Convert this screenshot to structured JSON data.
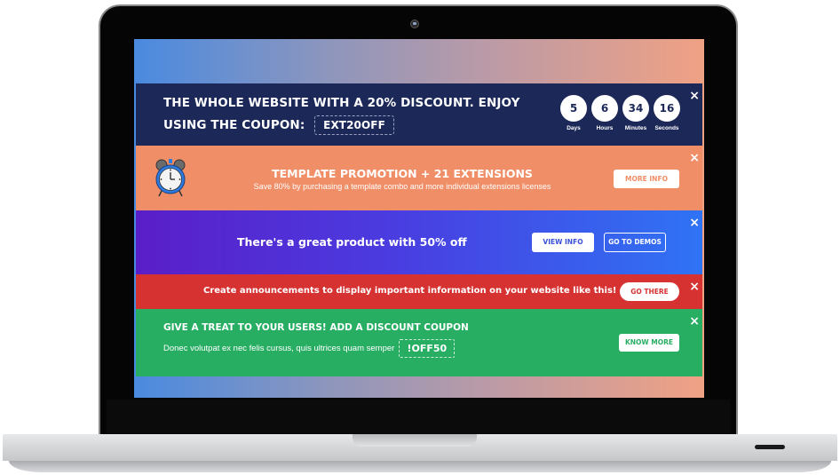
{
  "banners": {
    "countdown": {
      "headline": "THE WHOLE WEBSITE WITH A 20% DISCOUNT. ENJOY USING THE COUPON:",
      "coupon_code": "EXT20OFF",
      "timer": [
        {
          "value": "5",
          "label": "Days"
        },
        {
          "value": "6",
          "label": "Hours"
        },
        {
          "value": "34",
          "label": "Minutes"
        },
        {
          "value": "16",
          "label": "Seconds"
        }
      ],
      "close_icon": "×",
      "color": "#1c2858"
    },
    "promotion": {
      "icon": "alarm-clock-icon",
      "title": "TEMPLATE PROMOTION + 21 EXTENSIONS",
      "subtitle": "Save 80% by purchasing a template combo and more individual extensions licenses",
      "button_label": "MORE INFO",
      "close_icon": "×",
      "color": "#f08e67"
    },
    "product": {
      "title": "There's a great product with 50% off",
      "button1_label": "VIEW INFO",
      "button2_label": "GO TO DEMOS",
      "close_icon": "×",
      "gradient": [
        "#5a1ec8",
        "#2f73f5"
      ]
    },
    "announcement": {
      "title": "Create announcements to display important information on your website like this!",
      "button_label": "GO THERE",
      "close_icon": "×",
      "color": "#d63232"
    },
    "coupon": {
      "title": "GIVE A TREAT TO YOUR USERS! ADD A DISCOUNT COUPON",
      "subtitle": "Donec volutpat ex nec felis cursus, quis ultrices quam semper",
      "coupon_code": "!OFF50",
      "button_label": "KNOW MORE",
      "close_icon": "×",
      "color": "#27ae63"
    }
  }
}
